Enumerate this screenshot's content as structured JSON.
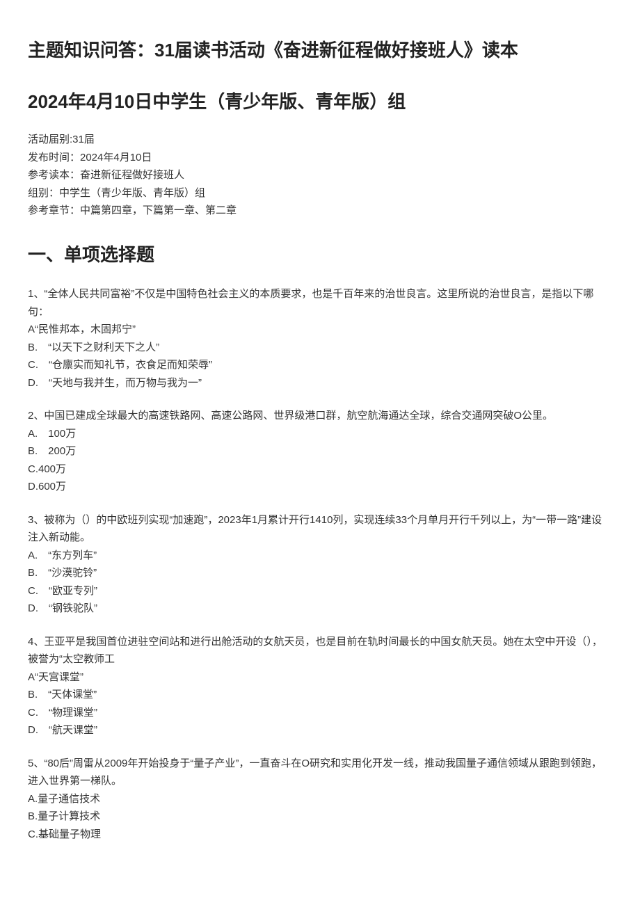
{
  "title_main": "主题知识问答：31届读书活动《奋进新征程做好接班人》读本",
  "title_sub": "2024年4月10日中学生（青少年版、青年版）组",
  "meta": {
    "session": "活动届别:31届",
    "publish_time": "发布时间：2024年4月10日",
    "reference_book": "参考读本：奋进新征程做好接班人",
    "group": "组别：中学生（青少年版、青年版）组",
    "reference_chapter": "参考章节：中篇第四章，下篇第一章、第二章"
  },
  "section1_heading": "一、单项选择题",
  "q1": {
    "text": "1、“全体人民共同富裕”不仅是中国特色社会主义的本质要求，也是千百年来的治世良言。这里所说的治世良言，是指以下哪句：",
    "a": "A“民惟邦本，木固邦宁”",
    "b": "B.　“以天下之财利天下之人”",
    "c": "C.　“仓廪实而知礼节，衣食足而知荣辱”",
    "d": "D.　“天地与我并生，而万物与我为一”"
  },
  "q2": {
    "text": "2、中国已建成全球最大的高速铁路网、高速公路网、世界级港口群，航空航海通达全球，综合交通网突破O公里。",
    "a": "A.　100万",
    "b": "B.　200万",
    "c": "C.400万",
    "d": "D.600万"
  },
  "q3": {
    "text": "3、被称为（）的中欧班列实现“加速跑”，2023年1月累计开行1410列，实现连续33个月单月开行千列以上，为“一带一路”建设注入新动能。",
    "a": "A.　“东方列车”",
    "b": "B.　“沙漠驼铃”",
    "c": "C.　“欧亚专列”",
    "d": "D.　“钢铁驼队”"
  },
  "q4": {
    "text": "4、王亚平是我国首位进驻空间站和进行出舱活动的女航天员，也是目前在轨时间最长的中国女航天员。她在太空中开设（），被誉为“太空教师工",
    "a": "A“天宫课堂”",
    "b": "B.　“天体课堂”",
    "c": "C.　“物理课堂”",
    "d": "D.　“航天课堂”"
  },
  "q5": {
    "text": "5、“80后”周雷从2009年开始投身于“量子产业”，一直奋斗在O研究和实用化开发一线，推动我国量子通信领域从跟跑到领跑，进入世界第一梯队。",
    "a": "A.量子通信技术",
    "b": "B.量子计算技术",
    "c": "C.基础量子物理"
  }
}
